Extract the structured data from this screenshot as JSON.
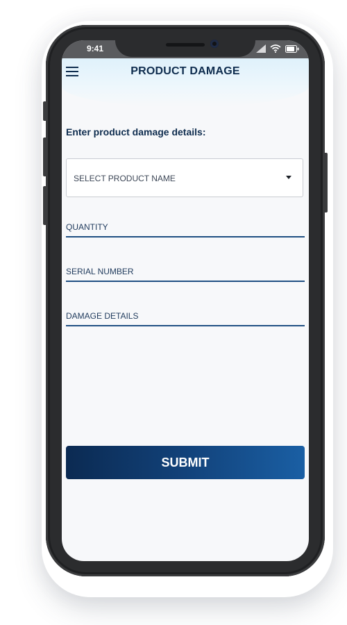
{
  "status_bar": {
    "time": "9:41",
    "icons": [
      "signal-icon",
      "wifi-icon",
      "battery-icon"
    ]
  },
  "header": {
    "menu_icon": "hamburger-menu-icon",
    "title": "PRODUCT DAMAGE"
  },
  "form": {
    "heading": "Enter product damage details:",
    "product_select": {
      "placeholder": "SELECT PRODUCT NAME",
      "icon": "chevron-down-icon"
    },
    "fields": [
      {
        "label": "QUANTITY",
        "value": ""
      },
      {
        "label": "SERIAL NUMBER",
        "value": ""
      },
      {
        "label": "DAMAGE DETAILS",
        "value": ""
      }
    ],
    "submit_label": "SUBMIT"
  },
  "colors": {
    "primary": "#0e2c4e",
    "button_gradient_start": "#0b2a52",
    "button_gradient_end": "#1a5fa4",
    "field_underline": "#1f4f82"
  }
}
